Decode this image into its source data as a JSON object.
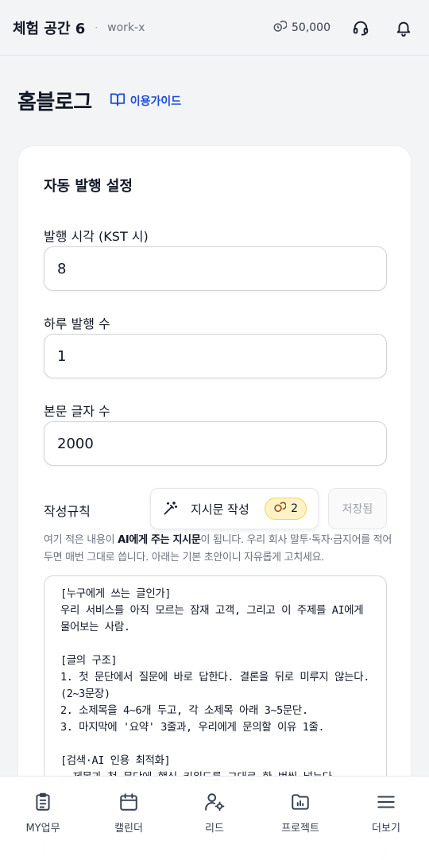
{
  "header": {
    "workspace_name": "체험 공간 6",
    "separator": "·",
    "workspace_slug": "work-x",
    "credits": "50,000"
  },
  "page": {
    "title": "홈블로그",
    "guide_link": "이용가이드"
  },
  "auto_publish": {
    "title": "자동 발행 설정",
    "publish_time": {
      "label": "발행 시각 (KST 시)",
      "value": "8"
    },
    "daily_count": {
      "label": "하루 발행 수",
      "value": "1"
    },
    "char_count": {
      "label": "본문 글자 수",
      "value": "2000"
    },
    "rules": {
      "label": "작성규칙",
      "write_button": "지시문 작성",
      "write_cost": "2",
      "saved_button": "저장됨",
      "help_prefix": "여기 적은 내용이 ",
      "help_bold1": "AI에게 주는 지시문",
      "help_mid": "이 됩니다. 우리 회사 말투·독자·금지어를 적어 두면 매번 그대로 씁니다. 아래는 기본 초안이니 자유롭게 고치세요.",
      "content": "[누구에게 쓰는 글인가]\n우리 서비스를 아직 모르는 잠재 고객, 그리고 이 주제를 AI에게 물어보는 사람.\n\n[글의 구조]\n1. 첫 문단에서 질문에 바로 답한다. 결론을 뒤로 미루지 않는다. (2~3문장)\n2. 소제목을 4~6개 두고, 각 소제목 아래 3~5문단.\n3. 마지막에 '요약' 3줄과, 우리에게 문의할 이유 1줄.\n\n[검색·AI 인용 최적화]\n- 제목과 첫 문단에 핵심 키워드를 그대로 한 번씩 넣는다."
    }
  },
  "bottom_nav": [
    {
      "label": "MY업무",
      "icon": "clipboard-icon"
    },
    {
      "label": "캘린더",
      "icon": "calendar-icon"
    },
    {
      "label": "리드",
      "icon": "user-gear-icon"
    },
    {
      "label": "프로젝트",
      "icon": "folder-chart-icon"
    },
    {
      "label": "더보기",
      "icon": "menu-icon"
    }
  ]
}
